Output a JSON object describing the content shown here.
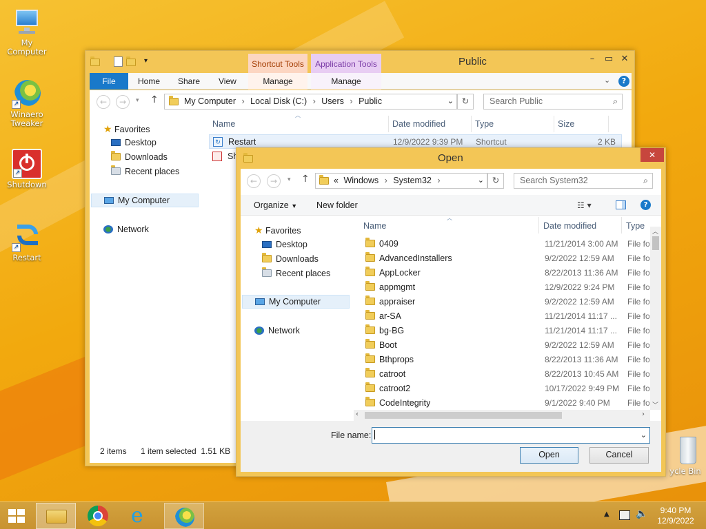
{
  "desktop": {
    "icons": [
      {
        "label": "My Computer",
        "icon": "computer-icon"
      },
      {
        "label": "Winaero Tweaker",
        "icon": "winaero-icon"
      },
      {
        "label": "Shutdown",
        "icon": "power-icon"
      },
      {
        "label": "Restart",
        "icon": "restart-icon"
      },
      {
        "label": "Recycle Bin",
        "label_visible": "ycle Bin",
        "icon": "recycle-bin-icon"
      }
    ]
  },
  "explorer": {
    "title": "Public",
    "ribbon_groups": {
      "shortcut_tools": "Shortcut Tools",
      "application_tools": "Application Tools"
    },
    "tabs": [
      "File",
      "Home",
      "Share",
      "View",
      "Manage",
      "Manage"
    ],
    "breadcrumb": [
      "My Computer",
      "Local Disk (C:)",
      "Users",
      "Public"
    ],
    "search_placeholder": "Search Public",
    "columns": {
      "name": "Name",
      "date": "Date modified",
      "type": "Type",
      "size": "Size"
    },
    "files": [
      {
        "name": "Restart",
        "date": "12/9/2022 9:39 PM",
        "type": "Shortcut",
        "size": "2 KB"
      },
      {
        "name": "Sh",
        "date": "",
        "type": "",
        "size": ""
      }
    ],
    "nav": {
      "favorites": "Favorites",
      "desktop": "Desktop",
      "downloads": "Downloads",
      "recent": "Recent places",
      "computer": "My Computer",
      "network": "Network"
    },
    "status": {
      "items": "2 items",
      "selected": "1 item selected  1.51 KB"
    }
  },
  "open_dialog": {
    "title": "Open",
    "breadcrumb": [
      "«",
      "Windows",
      "System32"
    ],
    "search_placeholder": "Search System32",
    "toolbar": {
      "organize": "Organize",
      "new_folder": "New folder"
    },
    "columns": {
      "name": "Name",
      "date": "Date modified",
      "type": "Type"
    },
    "folders": [
      {
        "name": "0409",
        "date": "11/21/2014 3:00 AM",
        "type": "File fol"
      },
      {
        "name": "AdvancedInstallers",
        "date": "9/2/2022 12:59 AM",
        "type": "File fol"
      },
      {
        "name": "AppLocker",
        "date": "8/22/2013 11:36 AM",
        "type": "File fol"
      },
      {
        "name": "appmgmt",
        "date": "12/9/2022 9:24 PM",
        "type": "File fol"
      },
      {
        "name": "appraiser",
        "date": "9/2/2022 12:59 AM",
        "type": "File fol"
      },
      {
        "name": "ar-SA",
        "date": "11/21/2014 11:17 ...",
        "type": "File fol"
      },
      {
        "name": "bg-BG",
        "date": "11/21/2014 11:17 ...",
        "type": "File fol"
      },
      {
        "name": "Boot",
        "date": "9/2/2022 12:59 AM",
        "type": "File fol"
      },
      {
        "name": "Bthprops",
        "date": "8/22/2013 11:36 AM",
        "type": "File fol"
      },
      {
        "name": "catroot",
        "date": "8/22/2013 10:45 AM",
        "type": "File fol"
      },
      {
        "name": "catroot2",
        "date": "10/17/2022 9:49 PM",
        "type": "File fol"
      },
      {
        "name": "CodeIntegrity",
        "date": "9/1/2022 9:40 PM",
        "type": "File fol"
      }
    ],
    "nav": {
      "favorites": "Favorites",
      "desktop": "Desktop",
      "downloads": "Downloads",
      "recent": "Recent places",
      "computer": "My Computer",
      "network": "Network"
    },
    "filename_label": "File name:",
    "filename_value": "",
    "open_label": "Open",
    "cancel_label": "Cancel"
  },
  "taskbar": {
    "time": "9:40 PM",
    "date": "12/9/2022",
    "apps": [
      "file-explorer-icon",
      "chrome-icon",
      "internet-explorer-icon",
      "winaero-icon"
    ]
  }
}
